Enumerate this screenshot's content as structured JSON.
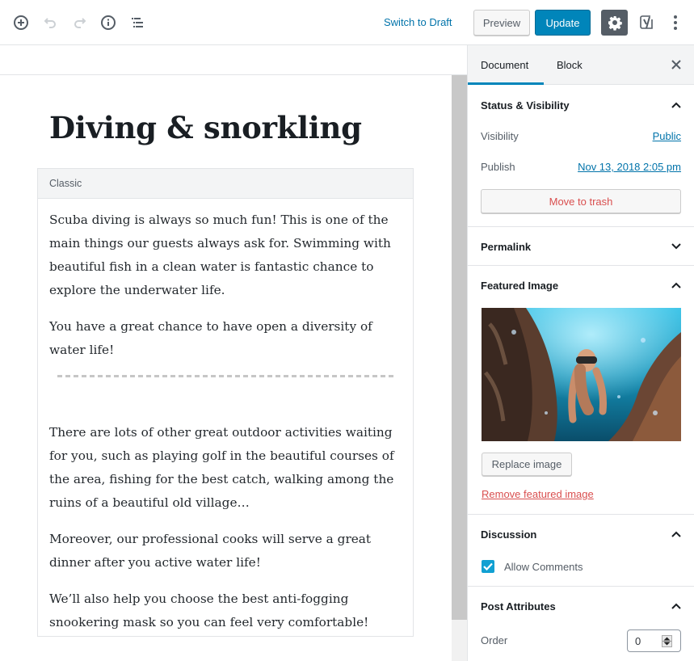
{
  "toolbar": {
    "icons": [
      "add-block-icon",
      "undo-icon",
      "redo-icon",
      "info-icon",
      "block-navigation-icon"
    ],
    "switch_to_draft": "Switch to Draft",
    "preview": "Preview",
    "update": "Update",
    "settings_icon": "gear-icon",
    "yoast_icon": "yoast-icon",
    "more_icon": "more-vertical-icon",
    "accent_color": "#0085ba"
  },
  "editor": {
    "title": "Diving & snorkling",
    "classic_block_label": "Classic",
    "paragraphs_before_more": [
      "Scuba diving is always so much fun! This is one of the main things our guests always ask for. Swimming with beautiful fish in a clean water is fantastic chance to explore the underwater life.",
      "You have a great chance to have open a diversity of water life!"
    ],
    "paragraphs_after_more": [
      "There are lots of other great outdoor activities waiting for you, such as playing golf in the beautiful courses of the area, fishing for the best catch, walking among the ruins of a beautiful old village…",
      "Moreover, our professional cooks will serve a great dinner after you active water life!",
      "We’ll also help you choose the best anti-fogging snookering mask so you can feel very comfortable!"
    ]
  },
  "sidebar": {
    "tabs": [
      {
        "label": "Document",
        "active": true
      },
      {
        "label": "Block",
        "active": false
      }
    ],
    "status_visibility": {
      "title": "Status & Visibility",
      "expanded": true,
      "visibility_label": "Visibility",
      "visibility_value": "Public",
      "publish_label": "Publish",
      "publish_value": "Nov 13, 2018 2:05 pm",
      "trash_button": "Move to trash"
    },
    "permalink": {
      "title": "Permalink",
      "expanded": false
    },
    "featured_image": {
      "title": "Featured Image",
      "expanded": true,
      "image_alt": "Snorkeler swimming underwater between rocks",
      "replace_button": "Replace image",
      "remove_link": "Remove featured image"
    },
    "discussion": {
      "title": "Discussion",
      "expanded": true,
      "allow_comments_label": "Allow Comments",
      "allow_comments_checked": true
    },
    "post_attributes": {
      "title": "Post Attributes",
      "expanded": true,
      "order_label": "Order",
      "order_value": "0"
    }
  }
}
